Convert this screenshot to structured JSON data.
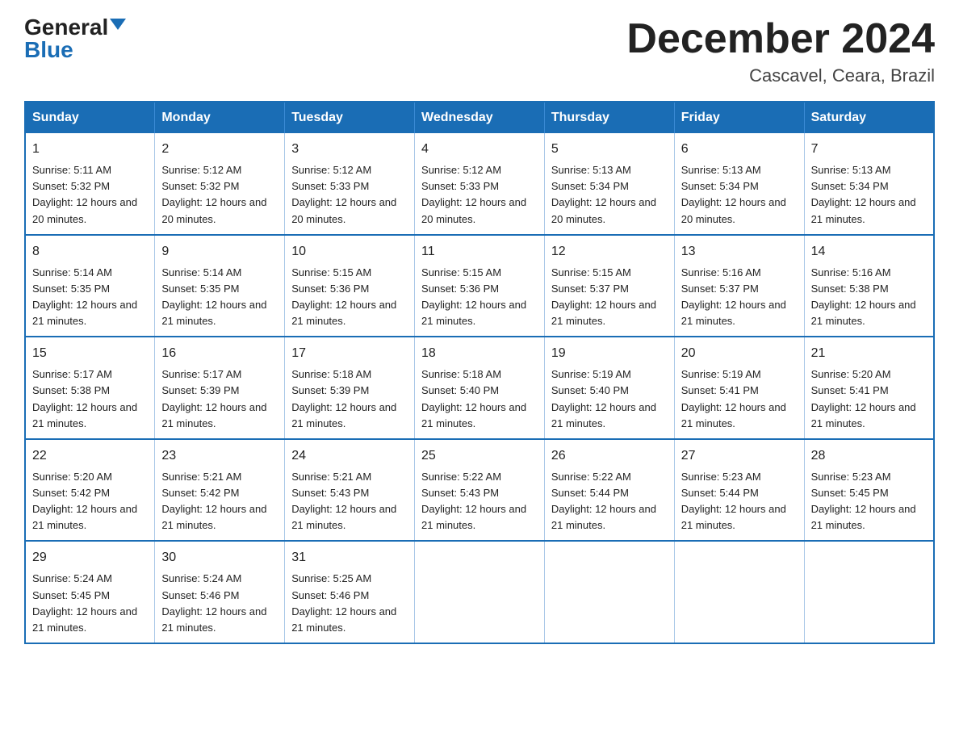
{
  "logo": {
    "general": "General",
    "blue": "Blue"
  },
  "title": "December 2024",
  "subtitle": "Cascavel, Ceara, Brazil",
  "headers": [
    "Sunday",
    "Monday",
    "Tuesday",
    "Wednesday",
    "Thursday",
    "Friday",
    "Saturday"
  ],
  "weeks": [
    [
      {
        "day": "1",
        "sunrise": "5:11 AM",
        "sunset": "5:32 PM",
        "daylight": "12 hours and 20 minutes."
      },
      {
        "day": "2",
        "sunrise": "5:12 AM",
        "sunset": "5:32 PM",
        "daylight": "12 hours and 20 minutes."
      },
      {
        "day": "3",
        "sunrise": "5:12 AM",
        "sunset": "5:33 PM",
        "daylight": "12 hours and 20 minutes."
      },
      {
        "day": "4",
        "sunrise": "5:12 AM",
        "sunset": "5:33 PM",
        "daylight": "12 hours and 20 minutes."
      },
      {
        "day": "5",
        "sunrise": "5:13 AM",
        "sunset": "5:34 PM",
        "daylight": "12 hours and 20 minutes."
      },
      {
        "day": "6",
        "sunrise": "5:13 AM",
        "sunset": "5:34 PM",
        "daylight": "12 hours and 20 minutes."
      },
      {
        "day": "7",
        "sunrise": "5:13 AM",
        "sunset": "5:34 PM",
        "daylight": "12 hours and 21 minutes."
      }
    ],
    [
      {
        "day": "8",
        "sunrise": "5:14 AM",
        "sunset": "5:35 PM",
        "daylight": "12 hours and 21 minutes."
      },
      {
        "day": "9",
        "sunrise": "5:14 AM",
        "sunset": "5:35 PM",
        "daylight": "12 hours and 21 minutes."
      },
      {
        "day": "10",
        "sunrise": "5:15 AM",
        "sunset": "5:36 PM",
        "daylight": "12 hours and 21 minutes."
      },
      {
        "day": "11",
        "sunrise": "5:15 AM",
        "sunset": "5:36 PM",
        "daylight": "12 hours and 21 minutes."
      },
      {
        "day": "12",
        "sunrise": "5:15 AM",
        "sunset": "5:37 PM",
        "daylight": "12 hours and 21 minutes."
      },
      {
        "day": "13",
        "sunrise": "5:16 AM",
        "sunset": "5:37 PM",
        "daylight": "12 hours and 21 minutes."
      },
      {
        "day": "14",
        "sunrise": "5:16 AM",
        "sunset": "5:38 PM",
        "daylight": "12 hours and 21 minutes."
      }
    ],
    [
      {
        "day": "15",
        "sunrise": "5:17 AM",
        "sunset": "5:38 PM",
        "daylight": "12 hours and 21 minutes."
      },
      {
        "day": "16",
        "sunrise": "5:17 AM",
        "sunset": "5:39 PM",
        "daylight": "12 hours and 21 minutes."
      },
      {
        "day": "17",
        "sunrise": "5:18 AM",
        "sunset": "5:39 PM",
        "daylight": "12 hours and 21 minutes."
      },
      {
        "day": "18",
        "sunrise": "5:18 AM",
        "sunset": "5:40 PM",
        "daylight": "12 hours and 21 minutes."
      },
      {
        "day": "19",
        "sunrise": "5:19 AM",
        "sunset": "5:40 PM",
        "daylight": "12 hours and 21 minutes."
      },
      {
        "day": "20",
        "sunrise": "5:19 AM",
        "sunset": "5:41 PM",
        "daylight": "12 hours and 21 minutes."
      },
      {
        "day": "21",
        "sunrise": "5:20 AM",
        "sunset": "5:41 PM",
        "daylight": "12 hours and 21 minutes."
      }
    ],
    [
      {
        "day": "22",
        "sunrise": "5:20 AM",
        "sunset": "5:42 PM",
        "daylight": "12 hours and 21 minutes."
      },
      {
        "day": "23",
        "sunrise": "5:21 AM",
        "sunset": "5:42 PM",
        "daylight": "12 hours and 21 minutes."
      },
      {
        "day": "24",
        "sunrise": "5:21 AM",
        "sunset": "5:43 PM",
        "daylight": "12 hours and 21 minutes."
      },
      {
        "day": "25",
        "sunrise": "5:22 AM",
        "sunset": "5:43 PM",
        "daylight": "12 hours and 21 minutes."
      },
      {
        "day": "26",
        "sunrise": "5:22 AM",
        "sunset": "5:44 PM",
        "daylight": "12 hours and 21 minutes."
      },
      {
        "day": "27",
        "sunrise": "5:23 AM",
        "sunset": "5:44 PM",
        "daylight": "12 hours and 21 minutes."
      },
      {
        "day": "28",
        "sunrise": "5:23 AM",
        "sunset": "5:45 PM",
        "daylight": "12 hours and 21 minutes."
      }
    ],
    [
      {
        "day": "29",
        "sunrise": "5:24 AM",
        "sunset": "5:45 PM",
        "daylight": "12 hours and 21 minutes."
      },
      {
        "day": "30",
        "sunrise": "5:24 AM",
        "sunset": "5:46 PM",
        "daylight": "12 hours and 21 minutes."
      },
      {
        "day": "31",
        "sunrise": "5:25 AM",
        "sunset": "5:46 PM",
        "daylight": "12 hours and 21 minutes."
      },
      null,
      null,
      null,
      null
    ]
  ]
}
